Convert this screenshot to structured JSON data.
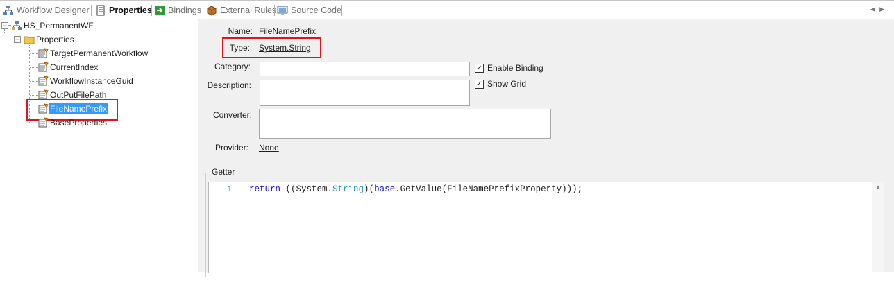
{
  "tabs": [
    {
      "label": "Workflow Designer",
      "icon": "workflow-designer-icon"
    },
    {
      "label": "Properties",
      "icon": "properties-icon"
    },
    {
      "label": "Bindings",
      "icon": "bindings-icon"
    },
    {
      "label": "External Rules",
      "icon": "external-rules-icon"
    },
    {
      "label": "Source Code",
      "icon": "source-code-icon"
    }
  ],
  "tree": {
    "root": "HS_PermanentWF",
    "folder": "Properties",
    "items": [
      "TargetPermanentWorkflow",
      "CurrentIndex",
      "WorkflowInstanceGuid",
      "OutPutFilePath",
      "FileNamePrefix",
      "BaseProperties"
    ],
    "selected_index": 4
  },
  "form": {
    "name_label": "Name:",
    "name_value": "FileNamePrefix",
    "type_label": "Type:",
    "type_value": "System.String",
    "category_label": "Category:",
    "category_value": "",
    "description_label": "Description:",
    "description_value": "",
    "converter_label": "Converter:",
    "converter_value": "",
    "provider_label": "Provider:",
    "provider_value": "None",
    "enable_binding_label": "Enable Binding",
    "enable_binding_checked": true,
    "show_grid_label": "Show Grid",
    "show_grid_checked": true
  },
  "getter": {
    "title": "Getter",
    "line_number": "1",
    "code_tokens": {
      "kw_return": "return",
      "t1": " ((System.",
      "ty_string": "String",
      "t2": ")(",
      "kw_base": "base",
      "t3": ".GetValue(FileNamePrefixProperty)));"
    }
  },
  "colors": {
    "highlight_box": "#e0141e",
    "selection": "#3399ff",
    "keyword": "#1010d0",
    "type_name": "#2b91af",
    "pane_background": "#f0f0f0"
  }
}
